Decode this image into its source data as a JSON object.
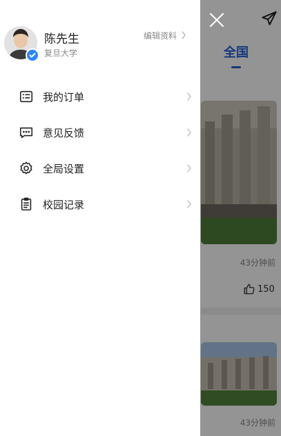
{
  "profile": {
    "name": "陈先生",
    "school": "复旦大学",
    "edit_label": "编辑资料",
    "avatar_icon": "user-avatar",
    "verified_icon": "verified-check-icon"
  },
  "menu": {
    "items": [
      {
        "label": "我的订单",
        "icon": "order-list-icon"
      },
      {
        "label": "意见反馈",
        "icon": "feedback-chat-icon"
      },
      {
        "label": "全局设置",
        "icon": "settings-gear-icon"
      },
      {
        "label": "校园记录",
        "icon": "clipboard-icon"
      }
    ]
  },
  "background": {
    "tab_label": "全国",
    "posts": [
      {
        "time": "43分钟前",
        "likes": "150"
      },
      {
        "time": "43分钟前"
      }
    ]
  },
  "colors": {
    "accent": "#1f5fd6",
    "verified": "#2f86f6",
    "overlay": "rgba(0,0,0,0.42)"
  }
}
